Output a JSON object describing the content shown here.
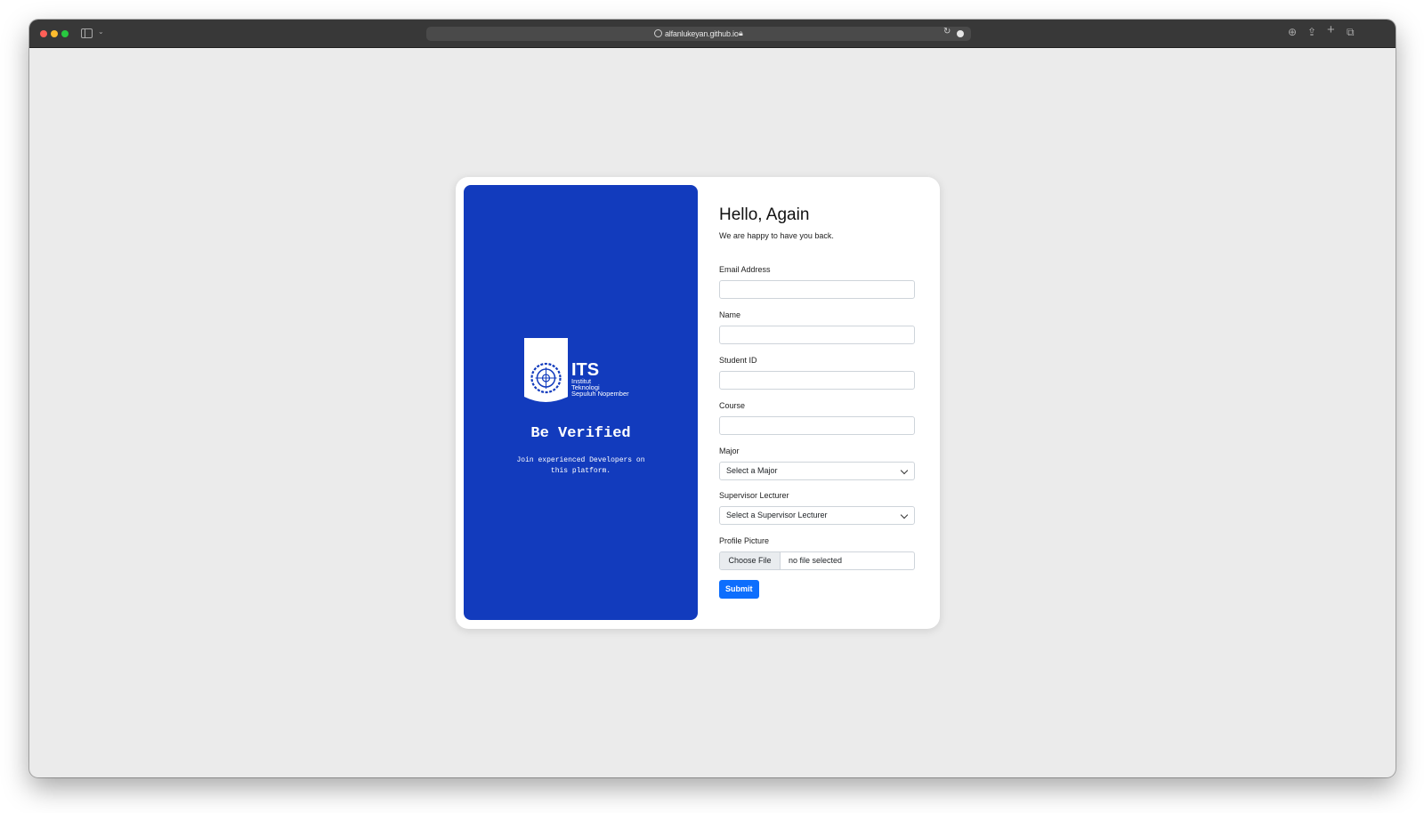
{
  "browser": {
    "url": "alfanlukeyan.github.io"
  },
  "brand": {
    "logo_text": "ITS",
    "logo_line1": "Institut",
    "logo_line2": "Teknologi",
    "logo_line3": "Sepuluh Nopember",
    "title": "Be Verified",
    "subtitle": "Join experienced Developers on this platform."
  },
  "form": {
    "title": "Hello, Again",
    "subtitle": "We are happy to have you back.",
    "email_label": "Email Address",
    "email_value": "",
    "name_label": "Name",
    "name_value": "",
    "student_id_label": "Student ID",
    "student_id_value": "",
    "course_label": "Course",
    "course_value": "",
    "major_label": "Major",
    "major_selected": "Select a Major",
    "supervisor_label": "Supervisor Lecturer",
    "supervisor_selected": "Select a Supervisor Lecturer",
    "picture_label": "Profile Picture",
    "file_button": "Choose File",
    "file_status": "no file selected",
    "submit_label": "Submit"
  },
  "colors": {
    "brand_panel": "#123bbd",
    "submit": "#0d6efd",
    "page_bg": "#ebebeb"
  }
}
